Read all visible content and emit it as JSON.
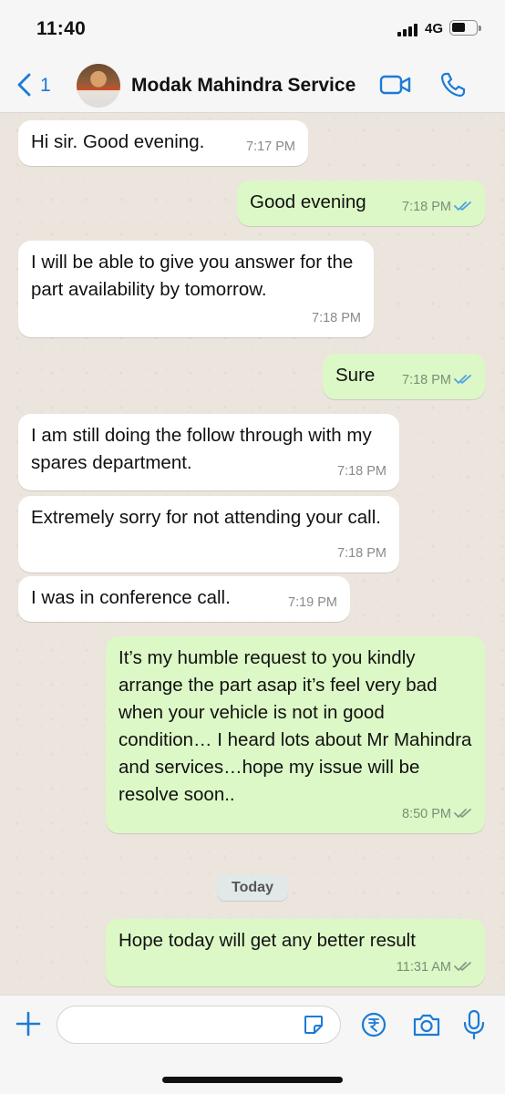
{
  "status_bar": {
    "time": "11:40",
    "network": "4G"
  },
  "header": {
    "back_count": "1",
    "contact_name": "Modak Mahindra Service"
  },
  "messages": [
    {
      "dir": "in",
      "text": "Hi sir. Good evening.",
      "time": "7:17 PM"
    },
    {
      "dir": "out",
      "text": "Good evening",
      "time": "7:18 PM",
      "status": "read"
    },
    {
      "dir": "in",
      "text": "I will be able to give you answer for the part availability by tomorrow.",
      "time": "7:18 PM"
    },
    {
      "dir": "out",
      "text": "Sure",
      "time": "7:18 PM",
      "status": "read"
    },
    {
      "dir": "in",
      "text": "I am still doing the follow through with my spares department.",
      "time": "7:18 PM"
    },
    {
      "dir": "in",
      "text": "Extremely sorry for not attending your call.",
      "time": "7:18 PM"
    },
    {
      "dir": "in",
      "text": "I was in conference call.",
      "time": "7:19 PM"
    },
    {
      "dir": "out",
      "text": "It’s my humble request to you kindly arrange the part asap it’s feel very bad when your vehicle is not in good condition… I heard lots about Mr Mahindra and services…hope my issue will be resolve soon..",
      "time": "8:50 PM",
      "status": "delivered"
    },
    {
      "dir": "out",
      "text": "Hope today will get any better result",
      "time": "11:31 AM",
      "status": "delivered"
    }
  ],
  "date_separator": "Today",
  "composer": {
    "placeholder": ""
  },
  "icons": {
    "back": "chevron-left-icon",
    "video": "video-camera-icon",
    "call": "phone-icon",
    "attach": "plus-icon",
    "sticker": "sticker-icon",
    "payment": "rupee-icon",
    "camera": "camera-icon",
    "voice": "microphone-icon",
    "read_ticks": "double-check-icon"
  },
  "colors": {
    "accent": "#1a7bd6",
    "incoming_bubble": "#ffffff",
    "outgoing_bubble": "#dcf8c6",
    "read_tick": "#4fa3e0",
    "delivered_tick": "#8a9a88"
  }
}
